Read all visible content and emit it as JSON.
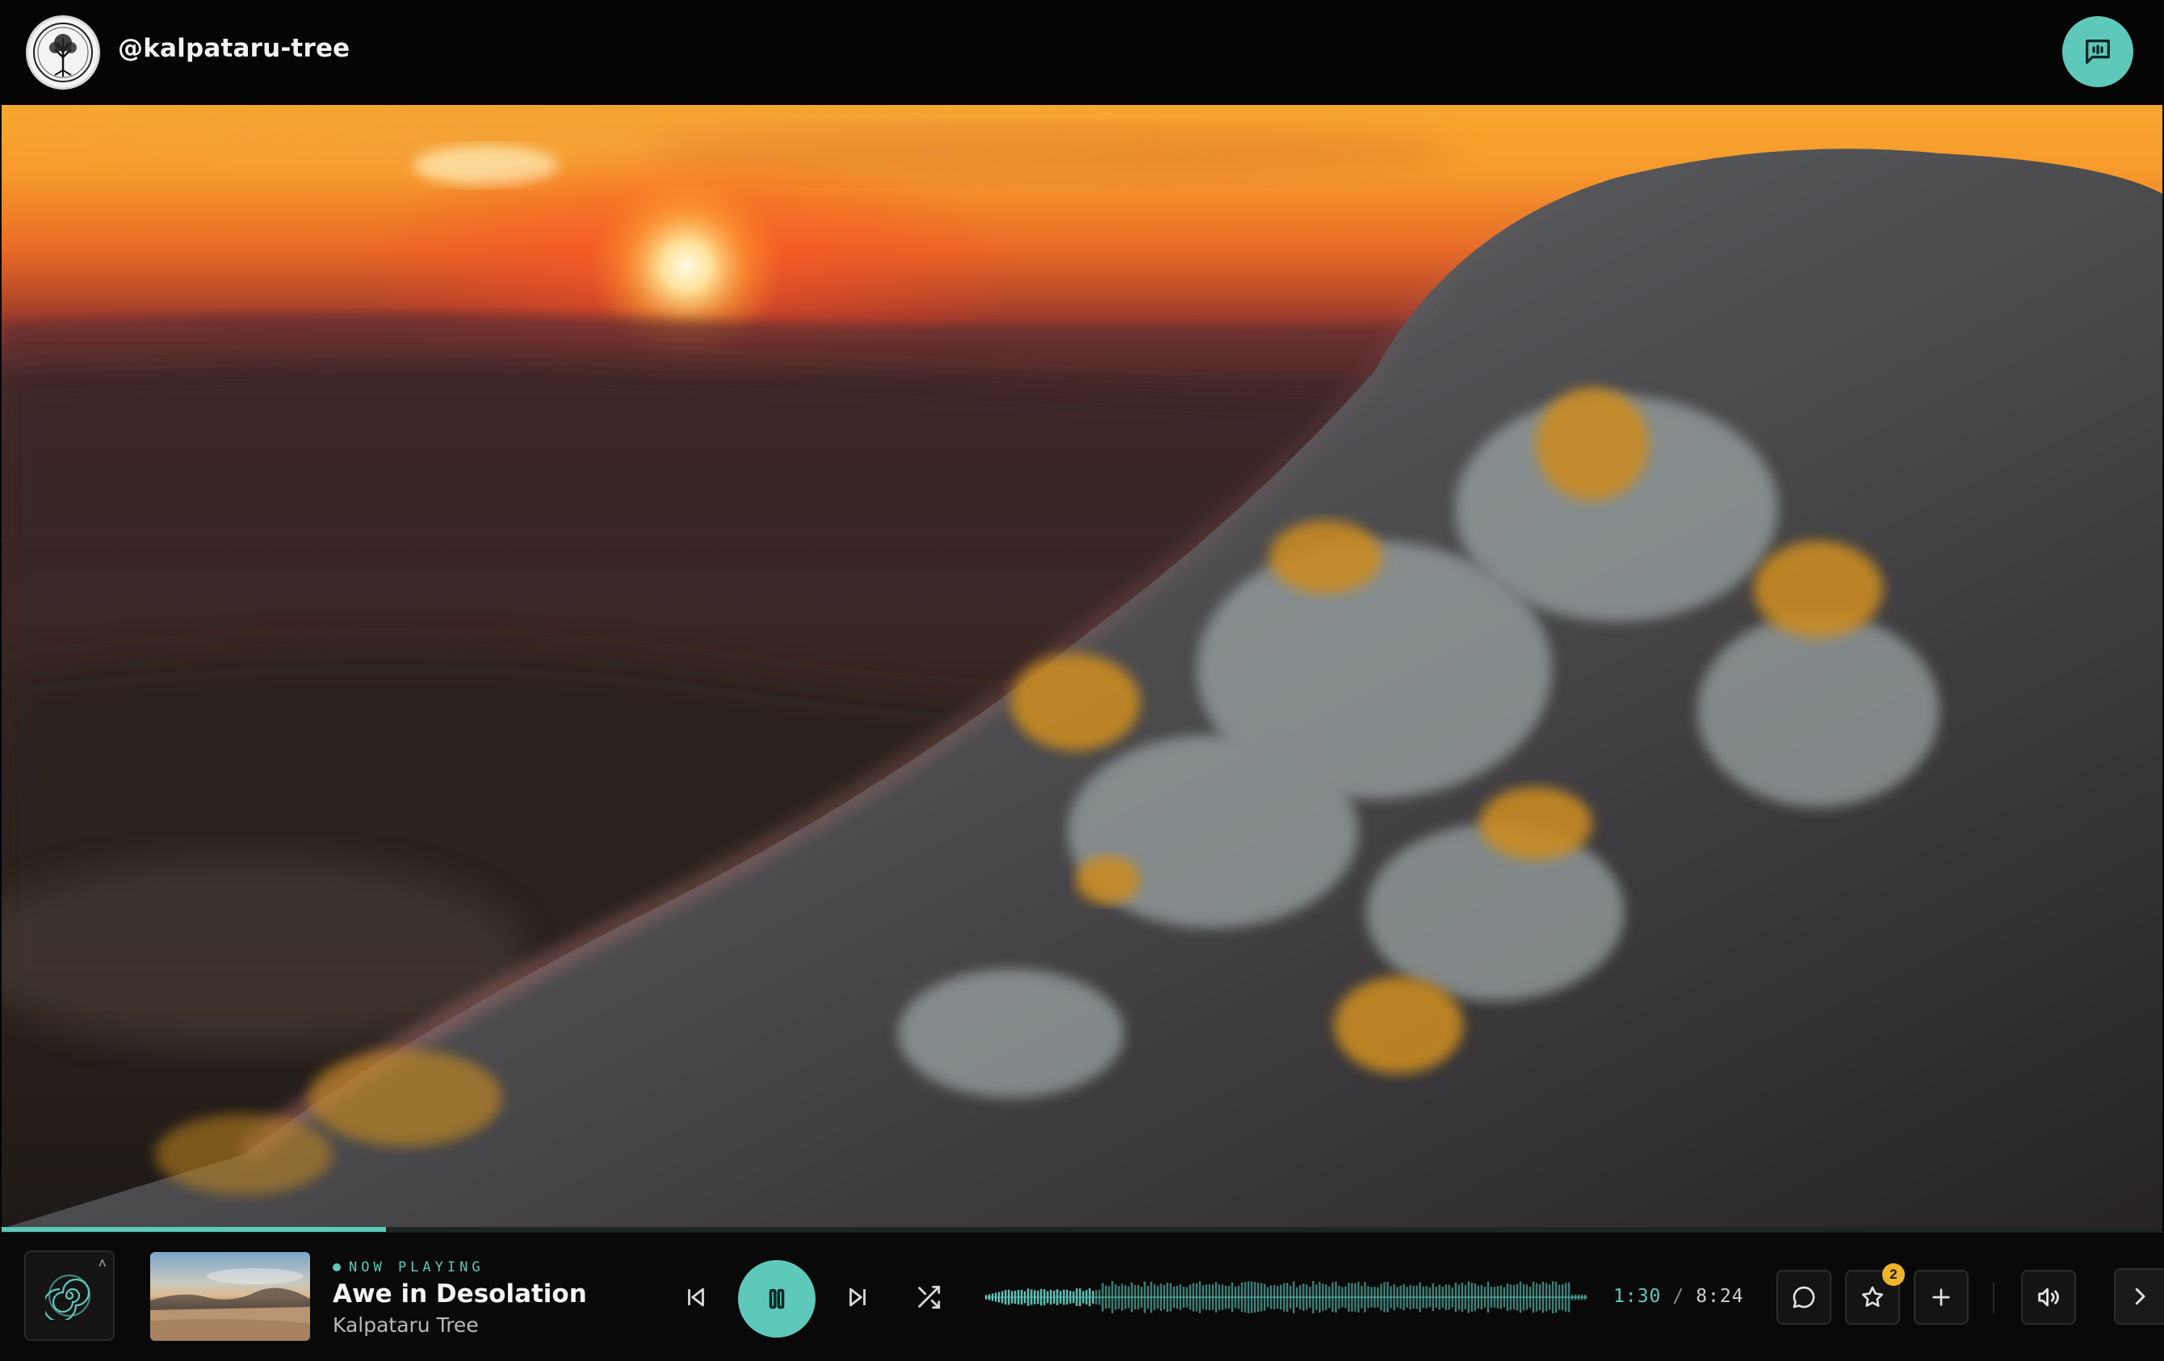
{
  "header": {
    "username": "@kalpataru-tree",
    "logo_icon": "tree-logo-icon",
    "chat_icon": "message-square-icon"
  },
  "colors": {
    "accent": "#5ec9bb",
    "background": "#050505",
    "badge": "#f0b429"
  },
  "player": {
    "now_playing_label": "NOW PLAYING",
    "track_title": "Awe in Desolation",
    "artist": "Kalpataru Tree",
    "current_time": "1:30",
    "separator": "/",
    "duration": "8:24",
    "progress_fraction": 0.178,
    "favorites_badge": "2",
    "icons": {
      "disc": "spiral-disc-icon",
      "previous": "skip-back-icon",
      "play_pause": "pause-icon",
      "next": "skip-forward-icon",
      "shuffle": "shuffle-icon",
      "comment": "comment-icon",
      "favorite": "star-icon",
      "add": "plus-icon",
      "volume": "volume-icon",
      "expand": "chevron-right-icon"
    }
  }
}
